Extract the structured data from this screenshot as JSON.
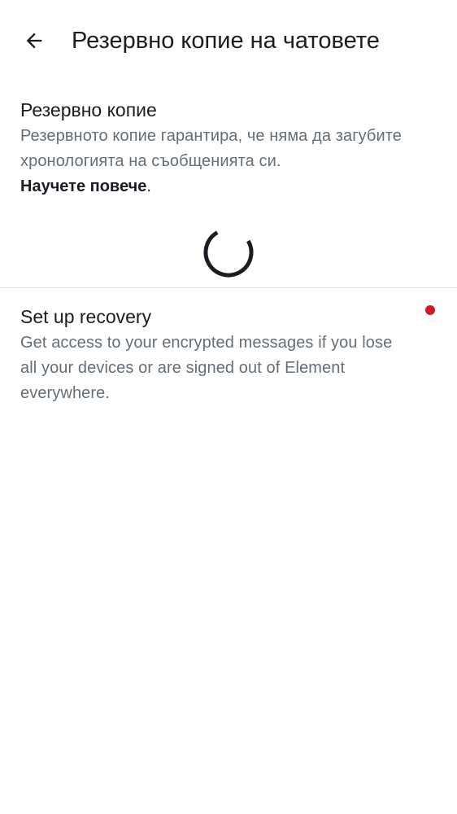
{
  "header": {
    "back_icon": "arrow-left-icon",
    "title": "Резервно копие на чатовете"
  },
  "backup": {
    "title": "Резервно копие",
    "description": "Резервното копие гарантира, че няма да загубите хронологията на съобщенията си.",
    "learn_more": "Научете повече",
    "learn_more_suffix": ".",
    "loading_icon": "spinner-icon"
  },
  "recovery": {
    "title": "Set up recovery",
    "description": "Get access to your encrypted messages if you lose all your devices or are signed out of Element everywhere.",
    "badge_color": "#d51928"
  }
}
